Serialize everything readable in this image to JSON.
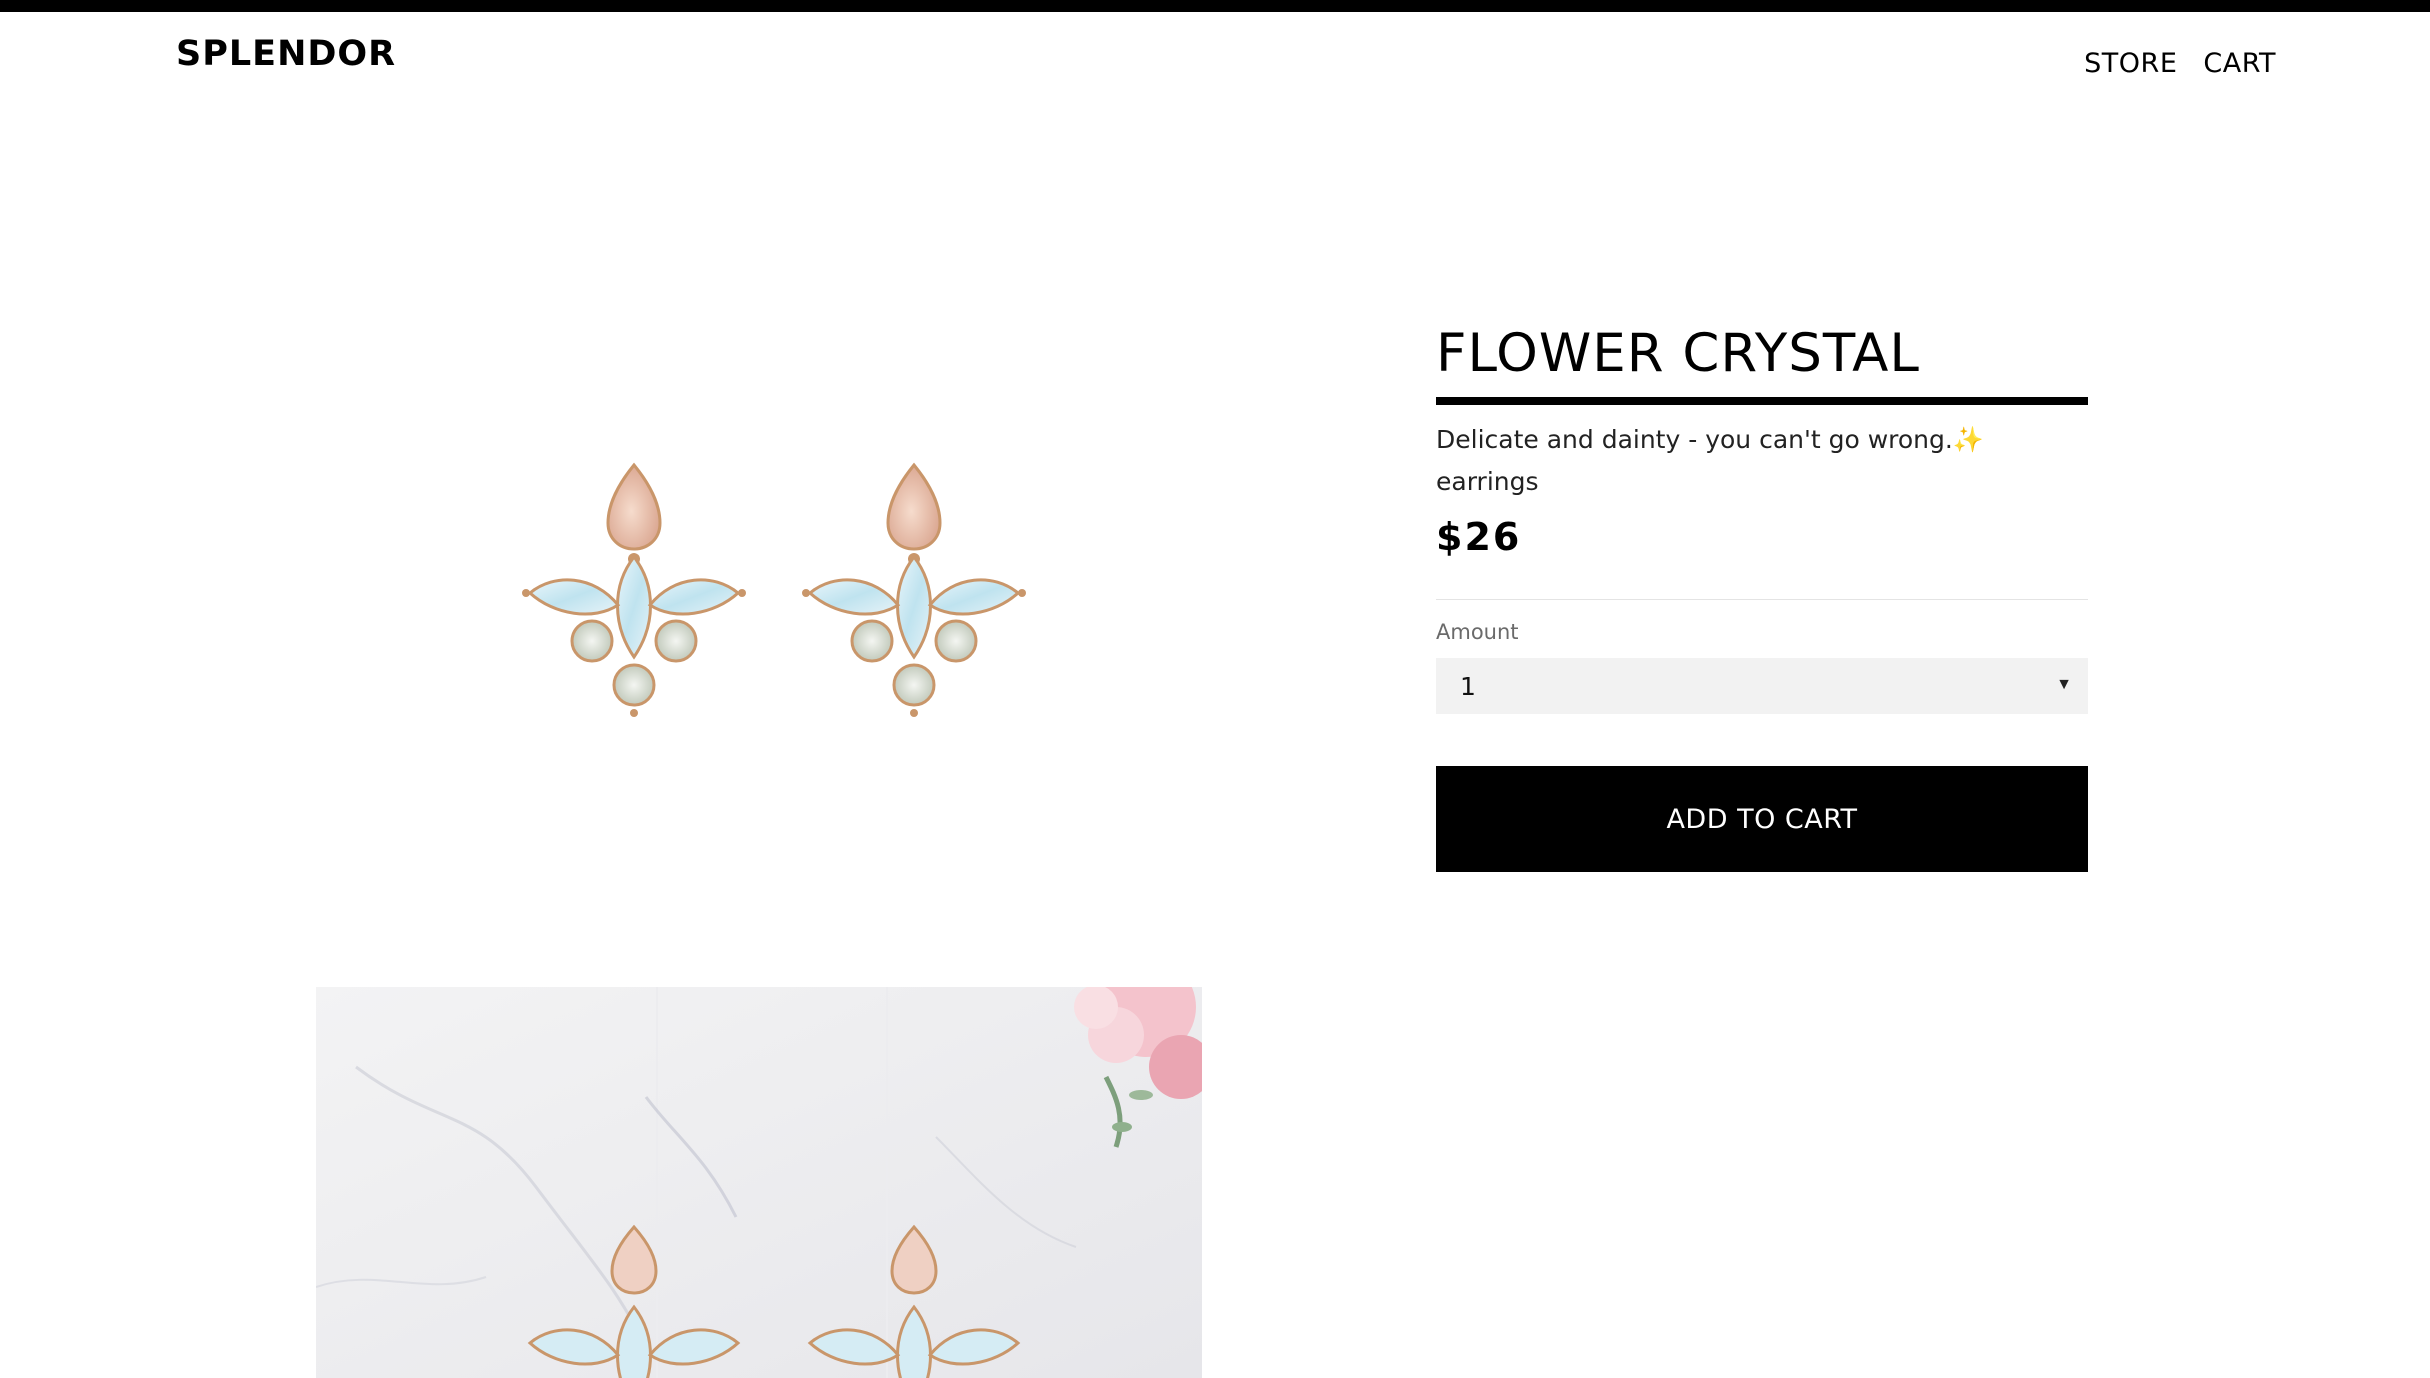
{
  "header": {
    "logo": "SPLENDOR",
    "nav": [
      "STORE",
      "CART"
    ]
  },
  "product": {
    "title": "FLOWER CRYSTAL",
    "description": "Delicate and dainty - you can't go wrong.",
    "description_emoji": "✨",
    "category": "earrings",
    "price": "$26"
  },
  "purchase": {
    "amount_label": "Amount",
    "amount_value": "1",
    "add_to_cart_label": "ADD TO CART"
  },
  "colors": {
    "button_bg": "#000000",
    "select_bg": "#f2f2f2",
    "topbar": "#000000"
  }
}
